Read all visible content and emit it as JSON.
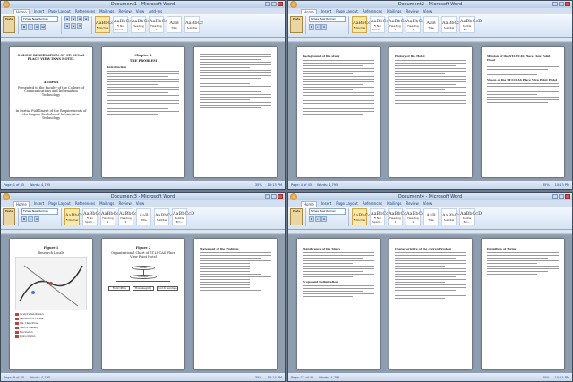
{
  "windows": [
    {
      "id": "q1",
      "title": "Document1 - Microsoft Word",
      "tabs": [
        "Home",
        "Insert",
        "Page Layout",
        "References",
        "Mailings",
        "Review",
        "View",
        "Add-Ins"
      ],
      "font": "Times New Roman",
      "size": "12",
      "styles": [
        "AaBbCcDc",
        "AaBbCcDc",
        "AaBbCc",
        "AaBbCc",
        "AaB",
        "AaBbCc",
        "AaBbCcD",
        "AaBbCcDc"
      ],
      "style_labels": [
        "¶ Normal",
        "¶ No Spaci...",
        "Heading 1",
        "Heading 2",
        "Title",
        "Subtitle",
        "Subtle Em...",
        "Emphasis"
      ],
      "status": "Page: 1 of 45",
      "words": "Words: 4,795",
      "zoom": "35%",
      "clock": "10:13 PM",
      "pages": {
        "p1_title": "ONLINE RESERVATION OF ST. LUCAS PLACE VIEW INNS HOTEL",
        "p1_sub": "A Thesis",
        "p1_college": "Presented to the Faculty of the College of Communications and Information Technology",
        "p1_req": "In Partial Fulfillment of the Requirements of the Degree Bachelor of Information Technology",
        "p2_chapter": "Chapter 1",
        "p2_problem": "THE PROBLEM",
        "p2_intro": "Introduction"
      }
    },
    {
      "id": "q2",
      "title": "Document2 - Microsoft Word",
      "status": "Page: 4 of 45",
      "words": "Words: 4,795",
      "zoom": "35%",
      "clock": "10:13 PM",
      "pages": {
        "p1_head": "Background of the study",
        "p2_head": "History of the Hotel",
        "p3_head": "Mission of the ST.LUCAS Place View Point Hotel",
        "p3_head2": "Vision of the ST.LUCAS Place View Point Hotel"
      }
    },
    {
      "id": "q3",
      "title": "Document3 - Microsoft Word",
      "status": "Page: 8 of 45",
      "words": "Words: 4,795",
      "zoom": "35%",
      "clock": "10:14 PM",
      "pages": {
        "p1_fig": "Figure 1",
        "p1_cap": "Research Locale",
        "p2_fig": "Figure 2",
        "p2_cap": "Organizational Chart of ST.LUCAS Place View Point Hotel",
        "p2_owner": "Owner",
        "p2_manager": "Manager",
        "p2_staff": [
          "Front Office",
          "Housekeeping",
          "Food & Beverage"
        ],
        "p3_head": "Statement of the Problem",
        "legend": [
          "Jocelyn's Subdivision",
          "Cathedral Of Lucena",
          "Sta. Clara Street",
          "Mall Of Alabang",
          "Bus Station",
          "Police Station"
        ]
      }
    },
    {
      "id": "q4",
      "title": "Document4 - Microsoft Word",
      "status": "Page: 11 of 45",
      "words": "Words: 4,795",
      "zoom": "35%",
      "clock": "10:14 PM",
      "pages": {
        "p1_head": "Significance of the Study",
        "p1_head2": "Scope and Delimitation",
        "p2_head": "Characteristics of the current System",
        "p3_head": "Definition of Terms"
      }
    }
  ]
}
